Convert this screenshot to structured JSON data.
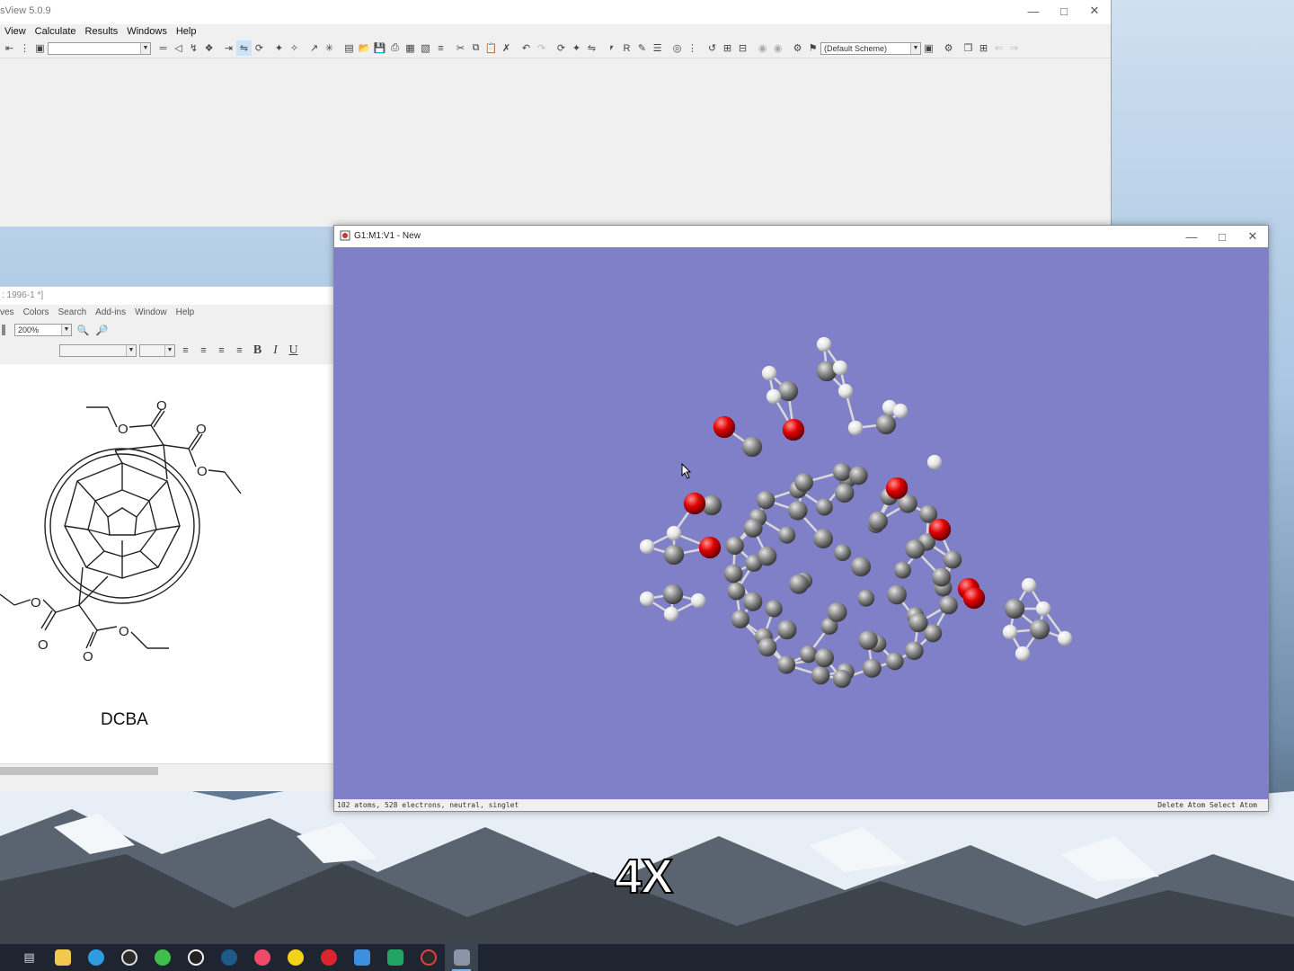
{
  "main_window": {
    "title": "sView 5.0.9",
    "menu": [
      "View",
      "Calculate",
      "Results",
      "Windows",
      "Help"
    ],
    "scheme_select": "(Default Scheme)"
  },
  "chemdraw": {
    "title": ": 1996-1 *]",
    "menu": [
      "ves",
      "Colors",
      "Search",
      "Add-ins",
      "Window",
      "Help"
    ],
    "zoom": "200%",
    "caption": "DCBA"
  },
  "molecule_window": {
    "title": "G1:M1:V1 - New",
    "status_left": "102 atoms, 528 electrons, neutral, singlet",
    "status_right": "Delete Atom Select Atom",
    "colors": {
      "background": "#8080c8",
      "carbon": "#8c8c8c",
      "oxygen": "#e00000",
      "hydrogen": "#f0f0f0"
    }
  },
  "overlay": {
    "speed": "4X"
  },
  "taskbar": {
    "apps": [
      "task-view-icon",
      "file-explorer-icon",
      "edge-icon",
      "chrome-icon",
      "wechat-icon",
      "qq-icon",
      "steam-icon",
      "music-icon",
      "norton-icon",
      "netease-music-icon",
      "mail-icon",
      "excel-icon",
      "clock-icon",
      "gaussview-icon"
    ]
  }
}
